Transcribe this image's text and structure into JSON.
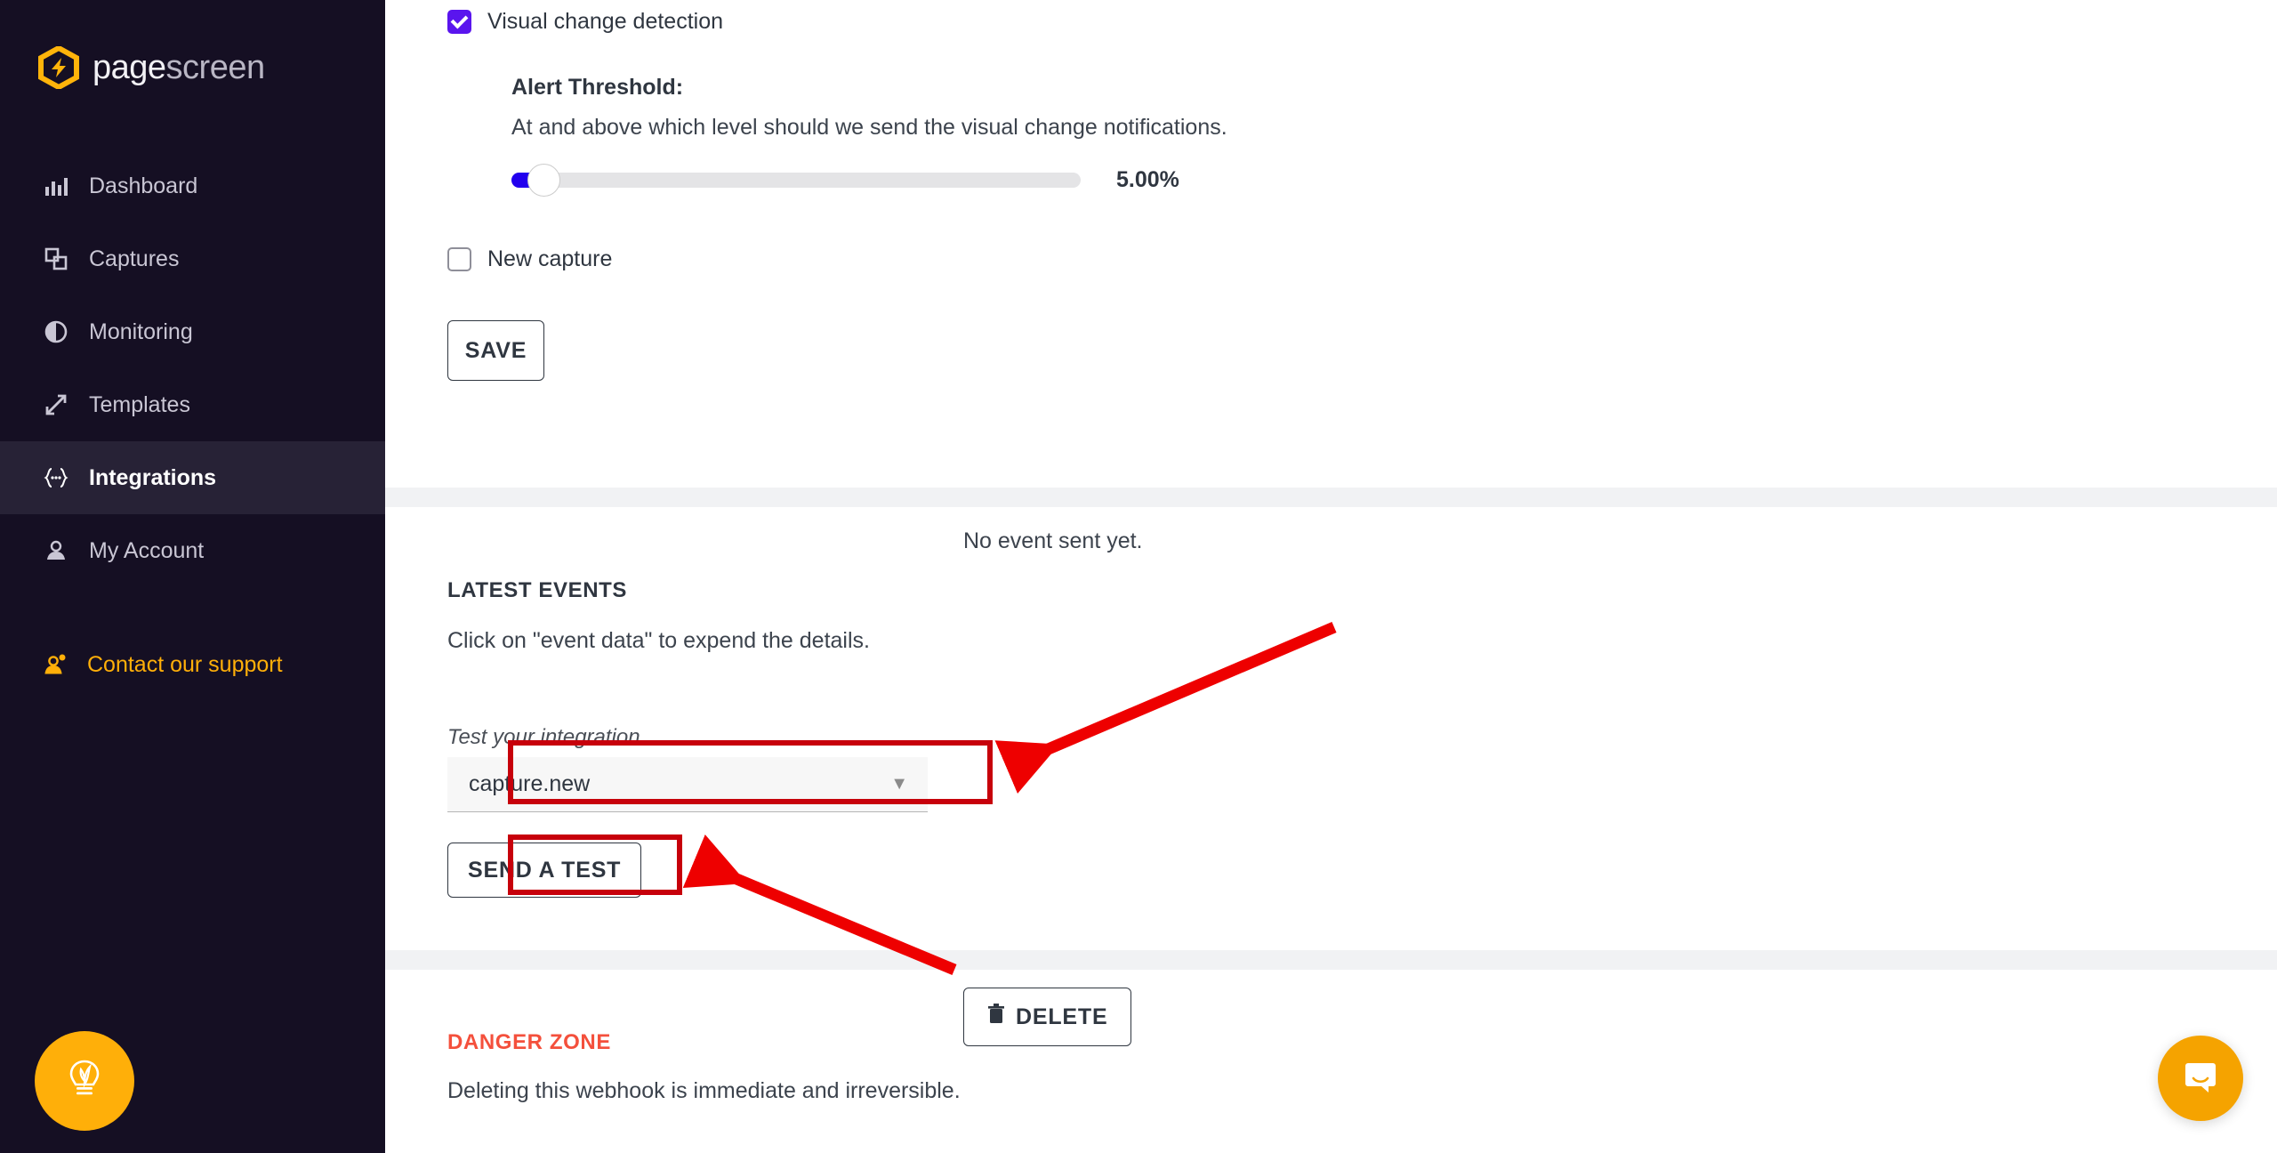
{
  "sidebar": {
    "brand": {
      "part1": "page",
      "part2": "screen",
      "logo_color": "#ffb40a"
    },
    "items": [
      {
        "label": "Dashboard",
        "icon": "bar-chart-icon",
        "active": false
      },
      {
        "label": "Captures",
        "icon": "copy-squares-icon",
        "active": false
      },
      {
        "label": "Monitoring",
        "icon": "contrast-circle-icon",
        "active": false
      },
      {
        "label": "Templates",
        "icon": "expand-arrows-icon",
        "active": false
      },
      {
        "label": "Integrations",
        "icon": "curly-braces-icon",
        "active": true
      },
      {
        "label": "My Account",
        "icon": "person-icon",
        "active": false
      }
    ],
    "support": {
      "label": "Contact our support",
      "icon": "support-person-icon",
      "color": "#ffaf09"
    },
    "help_fab": {
      "icon": "lightbulb-leaf-icon",
      "color": "#ffaf09"
    }
  },
  "settings": {
    "visual_change": {
      "label": "Visual change detection",
      "checked": true,
      "accent": "#5a15ee"
    },
    "alert_threshold": {
      "title": "Alert Threshold:",
      "description": "At and above which level should we send the visual change notifications.",
      "value_label": "5.00%",
      "percent": 5,
      "fill_color": "#2200ee"
    },
    "new_capture": {
      "label": "New capture",
      "checked": false
    },
    "save_label": "SAVE"
  },
  "latest_events": {
    "title": "LATEST EVENTS",
    "subtitle": "Click on \"event data\" to expend the details.",
    "status": "No event sent yet.",
    "test_label": "Test your integration",
    "select_value": "capture.new",
    "select_options": [
      "capture.new"
    ],
    "send_test_label": "SEND A TEST"
  },
  "danger_zone": {
    "title": "DANGER ZONE",
    "description": "Deleting this webhook is immediate and irreversible.",
    "delete_label": "DELETE",
    "delete_icon": "trash-icon",
    "title_color": "#f4503c"
  },
  "annotations": {
    "highlight_color": "#c7000b",
    "arrow_color": "#ee0000",
    "count": 2
  },
  "intercom": {
    "icon": "chat-bubble-icon",
    "color": "#f5a300"
  }
}
